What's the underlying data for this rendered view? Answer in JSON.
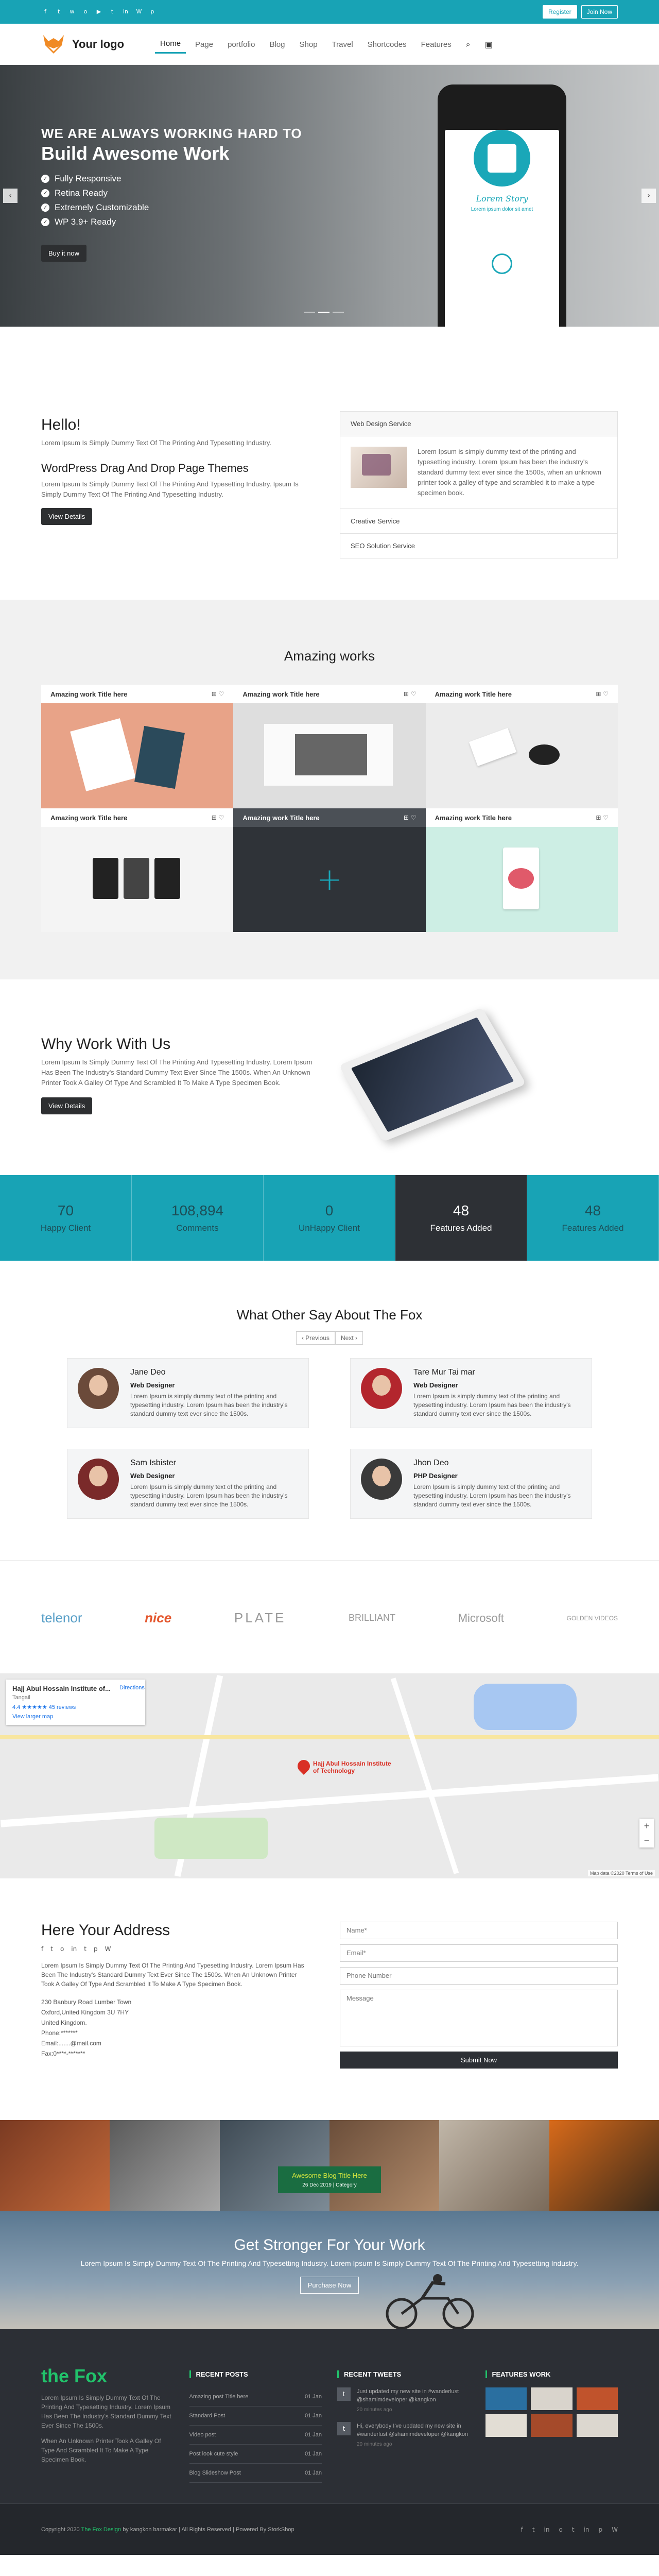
{
  "topbar": {
    "social_icons": [
      "facebook-icon",
      "twitter-icon",
      "whatsapp-icon",
      "instagram-icon",
      "youtube-icon",
      "tumblr-icon",
      "linkedin-icon",
      "wordpress-icon",
      "pinterest-icon"
    ],
    "social_glyphs": [
      "f",
      "t",
      "w",
      "o",
      "▶",
      "t",
      "in",
      "W",
      "p"
    ],
    "register_label": "Register",
    "login_label": "Join Now"
  },
  "header": {
    "logo_text": "Your logo",
    "nav": [
      "Home",
      "Page",
      "portfolio",
      "Blog",
      "Shop",
      "Travel",
      "Shortcodes",
      "Features"
    ],
    "active_index": 0
  },
  "hero": {
    "kicker": "WE ARE ALWAYS WORKING HARD TO",
    "title": "Build Awesome Work",
    "features": [
      "Fully Responsive",
      "Retina Ready",
      "Extremely Customizable",
      "WP 3.9+ Ready"
    ],
    "button_label": "Buy it now",
    "phone_title": "Lorem Story",
    "phone_sub": "Lorem ipsum dolor sit amet"
  },
  "hello": {
    "title": "Hello!",
    "text1": "Lorem Ipsum Is Simply Dummy Text Of The Printing And Typesetting Industry.",
    "subtitle": "WordPress Drag And Drop Page Themes",
    "text2": "Lorem Ipsum Is Simply Dummy Text Of The Printing And Typesetting Industry. Ipsum Is Simply Dummy Text Of The Printing And Typesetting Industry.",
    "button_label": "View Details",
    "accordion_head": "Web Design Service",
    "accordion_text": "Lorem Ipsum is simply dummy text of the printing and typesetting industry. Lorem Ipsum has been the industry's standard dummy text ever since the 1500s, when an unknown printer took a galley of type and scrambled it to make a type specimen book.",
    "accordion_items": [
      "Creative Service",
      "SEO Solution Service"
    ]
  },
  "works": {
    "title": "Amazing works",
    "item_title": "Amazing work Title here",
    "icons": "⊞ ♡"
  },
  "why": {
    "title": "Why Work With Us",
    "text": "Lorem Ipsum Is Simply Dummy Text Of The Printing And Typesetting Industry. Lorem Ipsum Has Been The Industry's Standard Dummy Text Ever Since The 1500s. When An Unknown Printer Took A Galley Of Type And Scrambled It To Make A Type Specimen Book.",
    "button_label": "View Details"
  },
  "stats": [
    {
      "num": "70",
      "label": "Happy Client"
    },
    {
      "num": "108,894",
      "label": "Comments"
    },
    {
      "num": "0",
      "label": "UnHappy Client"
    },
    {
      "num": "48",
      "label": "Features Added"
    },
    {
      "num": "48",
      "label": "Features Added"
    }
  ],
  "testimonials": {
    "title": "What Other Say About The Fox",
    "prev_label": "‹ Previous",
    "next_label": "Next ›",
    "items": [
      {
        "name": "Jane Deo",
        "role": "Web Designer",
        "text": "Lorem Ipsum is simply dummy text of the printing and typesetting industry. Lorem Ipsum has been the industry's standard dummy text ever since the 1500s."
      },
      {
        "name": "Tare Mur Tai mar",
        "role": "Web Designer",
        "text": "Lorem Ipsum is simply dummy text of the printing and typesetting industry. Lorem Ipsum has been the industry's standard dummy text ever since the 1500s."
      },
      {
        "name": "Sam Isbister",
        "role": "Web Designer",
        "text": "Lorem Ipsum is simply dummy text of the printing and typesetting industry. Lorem Ipsum has been the industry's standard dummy text ever since the 1500s."
      },
      {
        "name": "Jhon Deo",
        "role": "PHP Designer",
        "text": "Lorem Ipsum is simply dummy text of the printing and typesetting industry. Lorem Ipsum has been the industry's standard dummy text ever since the 1500s."
      }
    ]
  },
  "brands": [
    "telenor",
    "nice",
    "PLATE",
    "BRILLIANT",
    "Microsoft",
    "GOLDEN VIDEOS"
  ],
  "map": {
    "place_title": "Hajj Abul Hossain Institute of...",
    "place_address": "Tangail",
    "rating": "4.4 ★★★★★",
    "reviews": "45 reviews",
    "directions": "Directions",
    "view_larger": "View larger map",
    "pin_label": "Hajj Abul Hossain Institute of Technology",
    "footer": "Map data ©2020  Terms of Use"
  },
  "contact": {
    "title": "Here Your Address",
    "social_icons": [
      "facebook-icon",
      "twitter-icon",
      "instagram-icon",
      "linkedin-icon",
      "tumblr-icon",
      "pinterest-icon",
      "wordpress-icon"
    ],
    "social_glyphs": [
      "f",
      "t",
      "o",
      "in",
      "t",
      "p",
      "W"
    ],
    "text": "Lorem Ipsum Is Simply Dummy Text Of The Printing And Typesetting Industry. Lorem Ipsum Has Been The Industry's Standard Dummy Text Ever Since The 1500s. When An Unknown Printer Took A Galley Of Type And Scrambled It To Make A Type Specimen Book.",
    "lines": [
      "230 Banbury Road Lumber Town",
      "Oxford,United Kingdom 3U 7HY",
      "United Kingdom.",
      "Phone:*******",
      "Email:.......@mail.com",
      "Fax:0****-*******"
    ],
    "name_placeholder": "Name*",
    "email_placeholder": "Email*",
    "phone_placeholder": "Phone Number",
    "message_placeholder": "Message",
    "submit_label": "Submit Now"
  },
  "gallery": {
    "label_title": "Awesome Blog Title Here",
    "label_date": "26 Dec 2019 | Category"
  },
  "cta": {
    "title": "Get Stronger For Your Work",
    "text": "Lorem Ipsum Is Simply Dummy Text Of The Printing And Typesetting Industry. Lorem Ipsum Is Simply Dummy Text Of The Printing And Typesetting Industry.",
    "button_label": "Purchase Now"
  },
  "footer": {
    "brand": "the Fox",
    "text1": "Lorem Ipsum Is Simply Dummy Text Of The Printing And Typesetting Industry. Lorem Ipsum Has Been The Industry's Standard Dummy Text Ever Since The 1500s.",
    "text2": "When An Unknown Printer Took A Galley Of Type And Scrambled It To Make A Type Specimen Book.",
    "recent_posts_title": "RECENT POSTS",
    "posts": [
      {
        "title": "Amazing post Title here",
        "date": "01 Jan"
      },
      {
        "title": "Standard Post",
        "date": "01 Jan"
      },
      {
        "title": "Video post",
        "date": "01 Jan"
      },
      {
        "title": "Post look cute style",
        "date": "01 Jan"
      },
      {
        "title": "Blog Slideshow Post",
        "date": "01 Jan"
      }
    ],
    "tweets_title": "RECENT TWEETS",
    "tweets": [
      {
        "text": "Just updated my new site in #wanderlust @shamimdeveloper @kangkon",
        "time": "20 minutes ago"
      },
      {
        "text": "Hi, everybody I've updated my new site in #wanderlust @shamimdeveloper @kangkon",
        "time": "20 minutes ago"
      }
    ],
    "works_title": "FEATURES WORK",
    "copyright_prefix": "Copyright 2020",
    "copyright_brand": "The Fox Design",
    "copyright_suffix": "by kangkon barmakar | All Rights Reserved | Powered By StorkShop",
    "bottom_icons": [
      "facebook-icon",
      "twitter-icon",
      "linkedin-icon",
      "instagram-icon",
      "tumblr-icon",
      "linkedin-icon",
      "pinterest-icon",
      "wordpress-icon"
    ],
    "bottom_glyphs": [
      "f",
      "t",
      "in",
      "o",
      "t",
      "in",
      "p",
      "W"
    ]
  },
  "colors": {
    "accent": "#18a3b5",
    "dark": "#2d3035",
    "footer_green": "#21c36b"
  }
}
